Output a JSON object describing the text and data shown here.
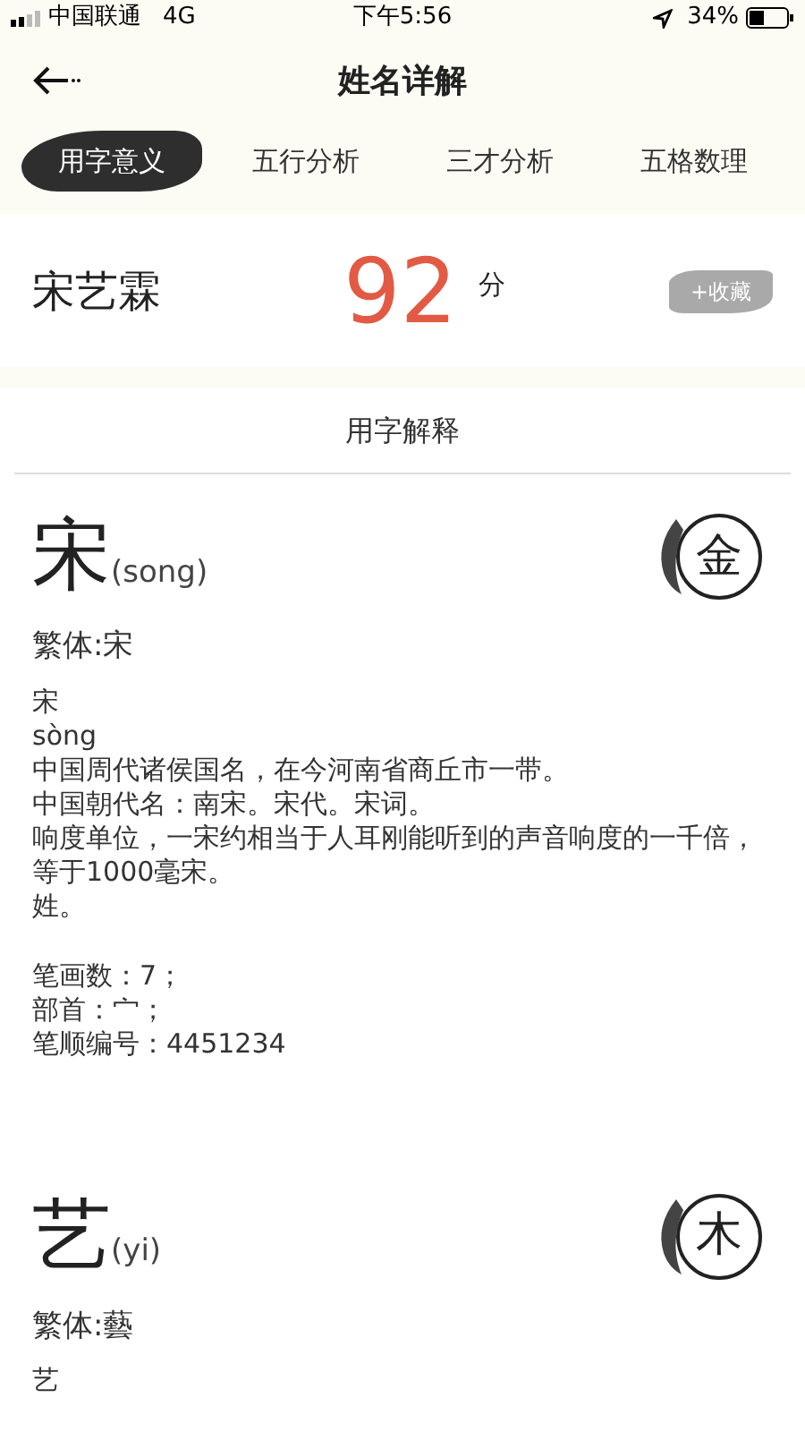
{
  "status_bar": {
    "carrier": "中国联通",
    "network": "4G",
    "time": "下午5:56",
    "battery": "34%"
  },
  "header": {
    "title": "姓名详解"
  },
  "tabs": [
    {
      "label": "用字意义",
      "selected": true
    },
    {
      "label": "五行分析",
      "selected": false
    },
    {
      "label": "三才分析",
      "selected": false
    },
    {
      "label": "五格数理",
      "selected": false
    }
  ],
  "summary": {
    "name": "宋艺霖",
    "score": "92",
    "score_unit": "分",
    "favorite_button": "+收藏"
  },
  "section_title": "用字解释",
  "characters": [
    {
      "char": "宋",
      "pinyin": "(song)",
      "element": "金",
      "traditional": "繁体:宋",
      "lines": [
        "宋",
        "sòng",
        "中国周代诸侯国名，在今河南省商丘市一带。",
        "中国朝代名：南宋。宋代。宋词。",
        "响度单位，一宋约相当于人耳刚能听到的声音响度的一千倍，等于1000毫宋。",
        "姓。"
      ],
      "stats": [
        "笔画数：7；",
        "部首：宀；",
        "笔顺编号：4451234"
      ]
    },
    {
      "char": "艺",
      "pinyin": "(yi)",
      "element": "木",
      "traditional": "繁体:藝",
      "lines": [
        "艺"
      ]
    }
  ]
}
